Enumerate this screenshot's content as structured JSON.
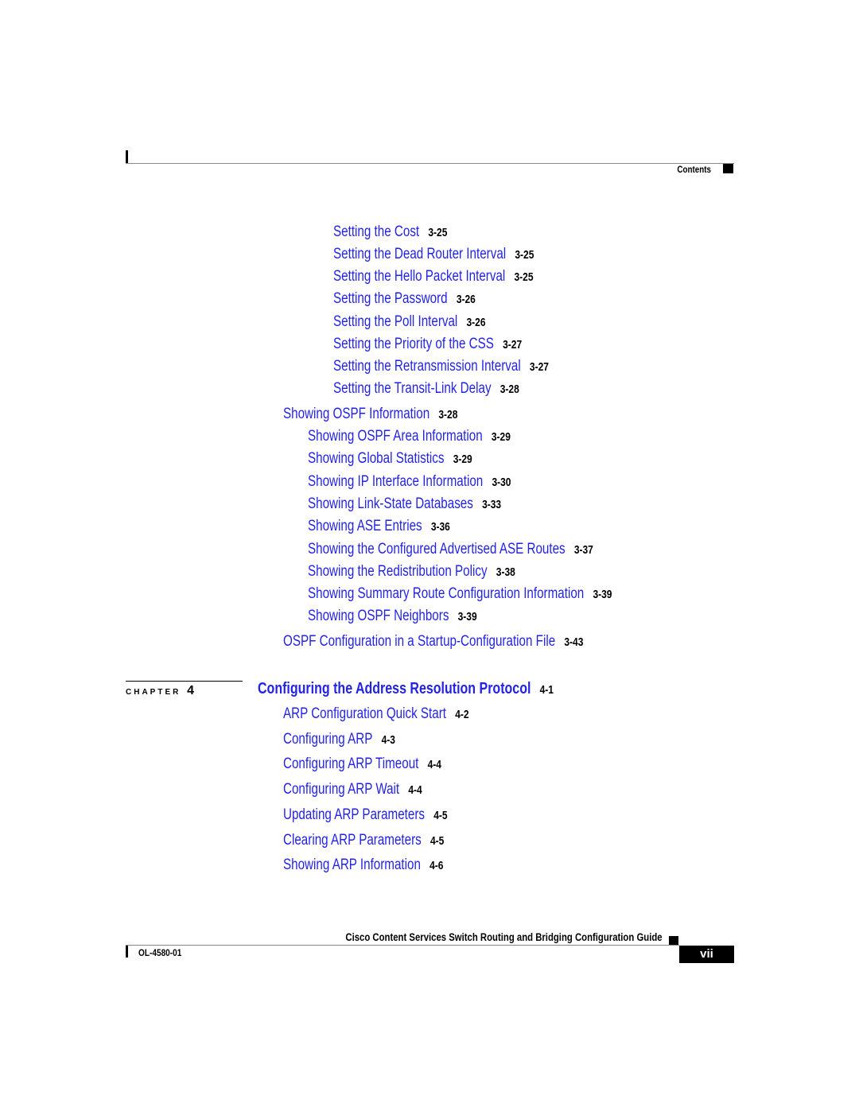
{
  "header": {
    "section_label": "Contents"
  },
  "toc": {
    "pre_entries": [
      {
        "title": "Setting the Cost",
        "page": "3-25",
        "level": 3
      },
      {
        "title": "Setting the Dead Router Interval",
        "page": "3-25",
        "level": 3
      },
      {
        "title": "Setting the Hello Packet Interval",
        "page": "3-25",
        "level": 3
      },
      {
        "title": "Setting the Password",
        "page": "3-26",
        "level": 3
      },
      {
        "title": "Setting the Poll Interval",
        "page": "3-26",
        "level": 3
      },
      {
        "title": "Setting the Priority of the CSS",
        "page": "3-27",
        "level": 3
      },
      {
        "title": "Setting the Retransmission Interval",
        "page": "3-27",
        "level": 3
      },
      {
        "title": "Setting the Transit-Link Delay",
        "page": "3-28",
        "level": 3
      },
      {
        "title": "Showing OSPF Information",
        "page": "3-28",
        "level": 1
      },
      {
        "title": "Showing OSPF Area Information",
        "page": "3-29",
        "level": 2
      },
      {
        "title": "Showing Global Statistics",
        "page": "3-29",
        "level": 2
      },
      {
        "title": "Showing IP Interface Information",
        "page": "3-30",
        "level": 2
      },
      {
        "title": "Showing Link-State Databases",
        "page": "3-33",
        "level": 2
      },
      {
        "title": "Showing ASE Entries",
        "page": "3-36",
        "level": 2
      },
      {
        "title": "Showing the Configured Advertised ASE Routes",
        "page": "3-37",
        "level": 2
      },
      {
        "title": "Showing the Redistribution Policy",
        "page": "3-38",
        "level": 2
      },
      {
        "title": "Showing Summary Route Configuration Information",
        "page": "3-39",
        "level": 2
      },
      {
        "title": "Showing OSPF Neighbors",
        "page": "3-39",
        "level": 2
      },
      {
        "title": "OSPF Configuration in a Startup-Configuration File",
        "page": "3-43",
        "level": 1
      }
    ],
    "chapter": {
      "label": "CHAPTER",
      "number": "4",
      "title": "Configuring the Address Resolution Protocol",
      "page": "4-1"
    },
    "chapter_entries": [
      {
        "title": "ARP Configuration Quick Start",
        "page": "4-2",
        "level": 1
      },
      {
        "title": "Configuring ARP",
        "page": "4-3",
        "level": 1
      },
      {
        "title": "Configuring ARP Timeout",
        "page": "4-4",
        "level": 1
      },
      {
        "title": "Configuring ARP Wait",
        "page": "4-4",
        "level": 1
      },
      {
        "title": "Updating ARP Parameters",
        "page": "4-5",
        "level": 1
      },
      {
        "title": "Clearing ARP Parameters",
        "page": "4-5",
        "level": 1
      },
      {
        "title": "Showing ARP Information",
        "page": "4-6",
        "level": 1
      }
    ]
  },
  "footer": {
    "book_title": "Cisco Content Services Switch Routing and Bridging Configuration Guide",
    "doc_number": "OL-4580-01",
    "page_number": "vii"
  }
}
